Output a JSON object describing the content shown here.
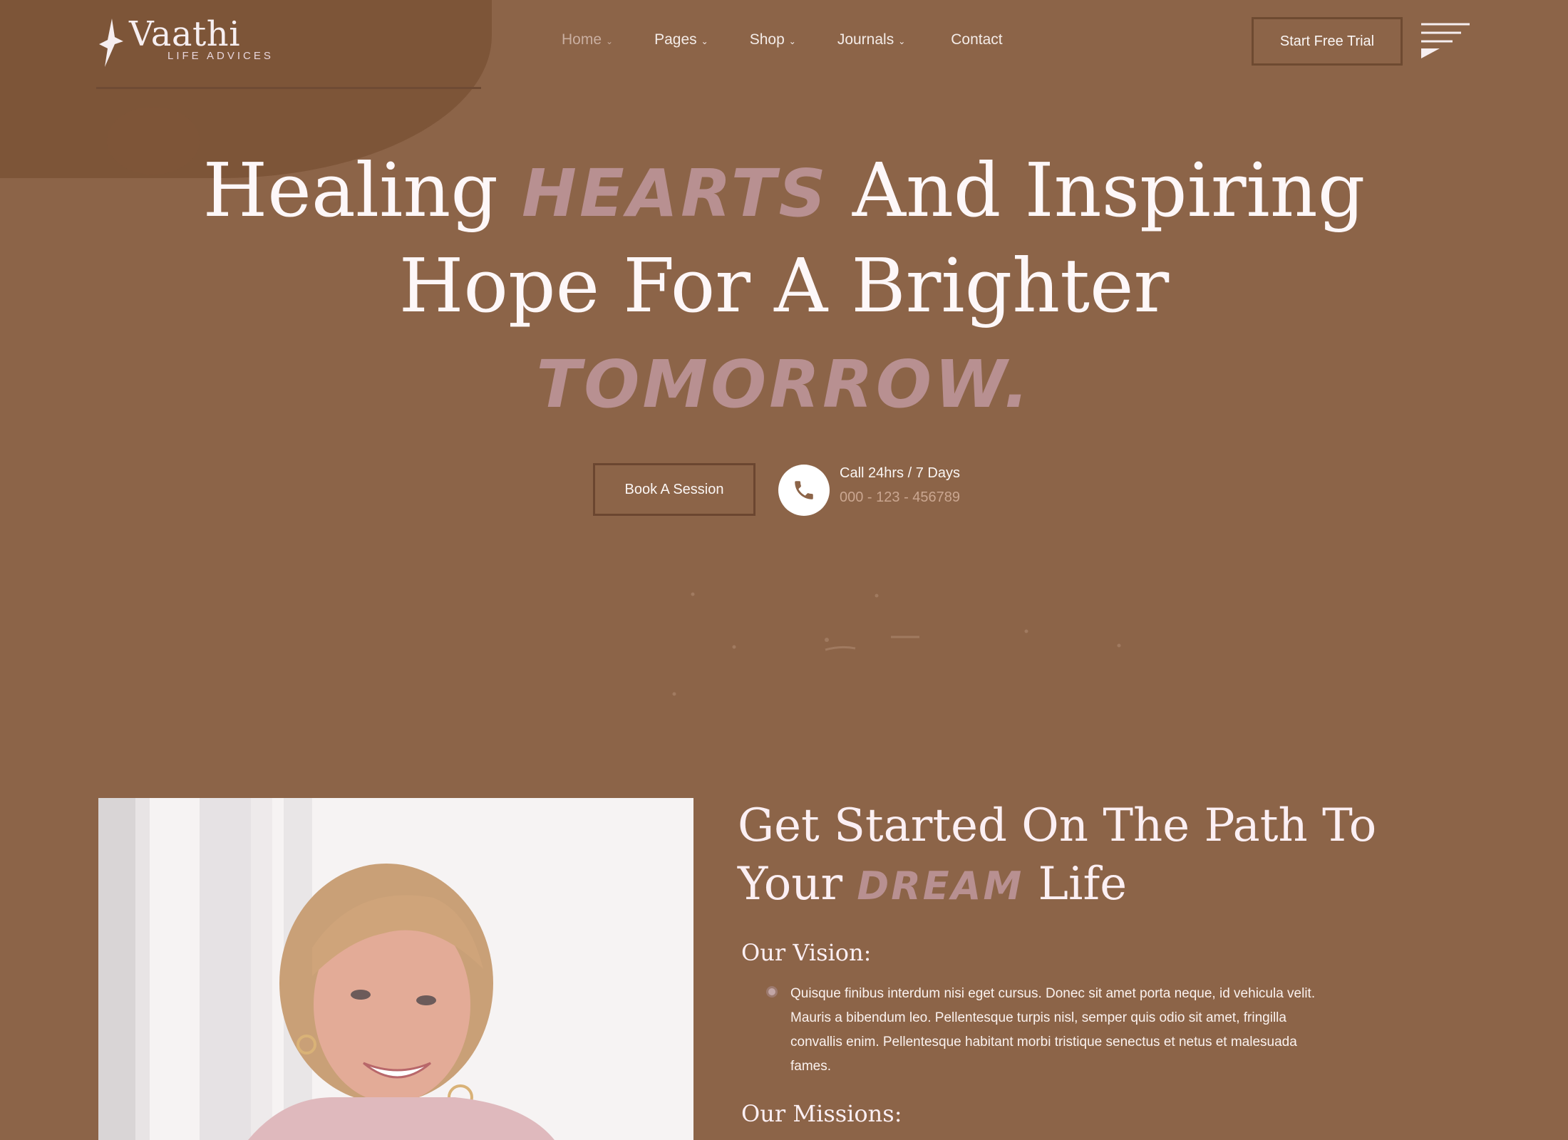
{
  "brand": {
    "name": "Vaathi",
    "tagline": "LIFE ADVICES"
  },
  "nav": {
    "items": [
      {
        "label": "Home",
        "has_dropdown": true,
        "active": true
      },
      {
        "label": "Pages",
        "has_dropdown": true
      },
      {
        "label": "Shop",
        "has_dropdown": true
      },
      {
        "label": "Journals",
        "has_dropdown": true
      },
      {
        "label": "Contact",
        "has_dropdown": false
      }
    ],
    "cta_label": "Start Free Trial"
  },
  "hero": {
    "line1_a": "Healing",
    "line1_script": "Hearts",
    "line1_b": "And Inspiring",
    "line2": "Hope For A Brighter",
    "line3_script": "Tomorrow."
  },
  "actions": {
    "book_label": "Book A Session",
    "call_label": "Call 24hrs / 7 Days",
    "call_number": "000 - 123 - 456789"
  },
  "section": {
    "title_a": "Get Started On The Path To",
    "title_b": "Your",
    "title_script": "Dream",
    "title_c": "Life",
    "vision_title": "Our Vision:",
    "vision_text": "Quisque finibus interdum nisi eget cursus. Donec sit amet porta neque, id vehicula velit. Mauris a bibendum leo. Pellentesque turpis nisl, semper quis odio sit amet, fringilla convallis enim. Pellentesque habitant morbi tristique senectus et netus et malesuada fames.",
    "missions_title": "Our Missions:"
  },
  "colors": {
    "background": "#8c6448",
    "accent_script": "#b89091",
    "text_light": "#fdf7f8"
  }
}
